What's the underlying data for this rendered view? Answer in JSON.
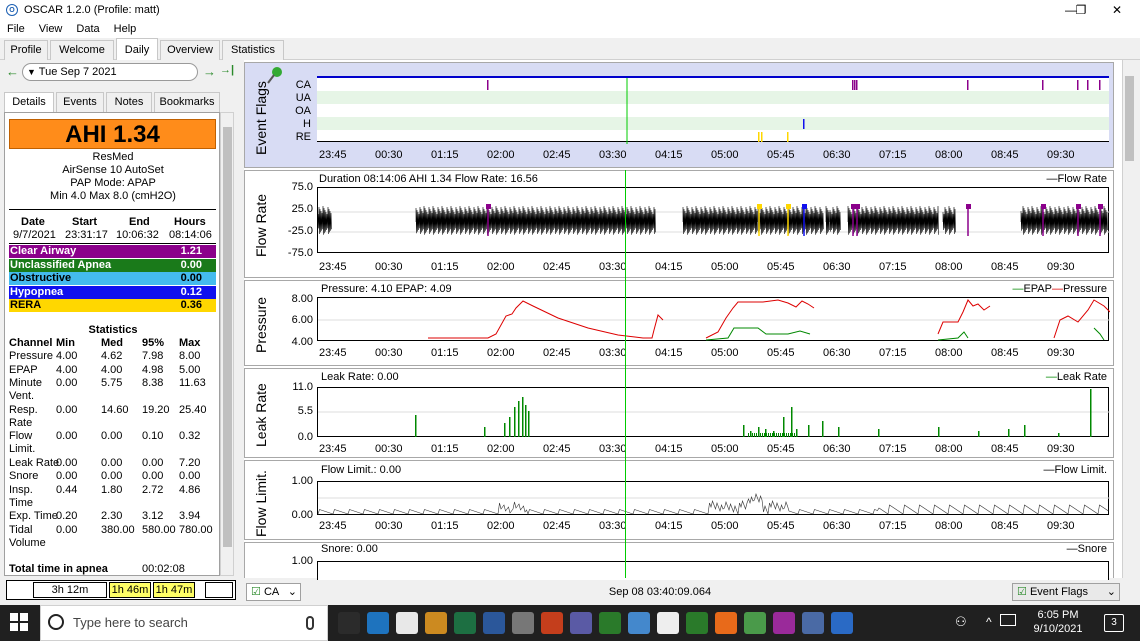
{
  "window": {
    "title": "OSCAR 1.2.0 (Profile: matt)",
    "minimize": "—",
    "maximize": "❐",
    "close": "✕"
  },
  "menu": [
    "File",
    "View",
    "Data",
    "Help"
  ],
  "tabs": [
    "Profile",
    "Welcome",
    "Daily",
    "Overview",
    "Statistics"
  ],
  "date_nav": {
    "back": "←",
    "forward": "→",
    "end": "→|",
    "date": "Tue Sep 7 2021",
    "dropdown_icon": "▼"
  },
  "subtabs": [
    "Details",
    "Events",
    "Notes",
    "Bookmarks"
  ],
  "details": {
    "ahi": "AHI 1.34",
    "device_brand": "ResMed",
    "device_model": "AirSense 10 AutoSet",
    "pap_mode": "PAP Mode: APAP",
    "pressure_range": "Min 4.0 Max 8.0 (cmH2O)",
    "session_headers": [
      "Date",
      "Start",
      "End",
      "Hours"
    ],
    "session_row": [
      "9/7/2021",
      "23:31:17",
      "10:06:32",
      "08:14:06"
    ],
    "events": [
      {
        "label": "Clear Airway",
        "value": "1.21",
        "color": "#8b008b",
        "text": "#ffffff"
      },
      {
        "label": "Unclassified Apnea",
        "value": "0.00",
        "color": "#1a7a1a",
        "text": "#ffffff"
      },
      {
        "label": "Obstructive",
        "value": "0.00",
        "color": "#44bbee",
        "text": "#000000"
      },
      {
        "label": "Hypopnea",
        "value": "0.12",
        "color": "#1010ee",
        "text": "#ffffff"
      },
      {
        "label": "RERA",
        "value": "0.36",
        "color": "#ffd700",
        "text": "#000000"
      }
    ],
    "stats_title": "Statistics",
    "stats_headers": [
      "Channel",
      "Min",
      "Med",
      "95%",
      "Max"
    ],
    "stats_rows": [
      {
        "name": "Pressure",
        "name2": "",
        "v": [
          "4.00",
          "4.62",
          "7.98",
          "8.00"
        ]
      },
      {
        "name": "EPAP",
        "name2": "",
        "v": [
          "4.00",
          "4.00",
          "4.98",
          "5.00"
        ]
      },
      {
        "name": "Minute",
        "name2": "Vent.",
        "v": [
          "0.00",
          "5.75",
          "8.38",
          "11.63"
        ]
      },
      {
        "name": "Resp.",
        "name2": "Rate",
        "v": [
          "0.00",
          "14.60",
          "19.20",
          "25.40"
        ]
      },
      {
        "name": "Flow",
        "name2": "Limit.",
        "v": [
          "0.00",
          "0.00",
          "0.10",
          "0.32"
        ]
      },
      {
        "name": "Leak Rate",
        "name2": "",
        "v": [
          "0.00",
          "0.00",
          "0.00",
          "7.20"
        ]
      },
      {
        "name": "Snore",
        "name2": "",
        "v": [
          "0.00",
          "0.00",
          "0.00",
          "0.00"
        ]
      },
      {
        "name": "Insp.",
        "name2": "Time",
        "v": [
          "0.44",
          "1.80",
          "2.72",
          "4.86"
        ]
      },
      {
        "name": "Exp. Time",
        "name2": "",
        "v": [
          "0.20",
          "2.30",
          "3.12",
          "3.94"
        ]
      },
      {
        "name": "Tidal",
        "name2": "Volume",
        "v": [
          "0.00",
          "380.00",
          "580.00",
          "780.00"
        ]
      }
    ],
    "total_apnea_label": "Total time in apnea",
    "total_apnea_value": "00:02:08"
  },
  "bottom_left": [
    "3h 12m",
    "1h 46m",
    "1h 47m"
  ],
  "time_ticks": [
    "23:45",
    "00:30",
    "01:15",
    "02:00",
    "02:45",
    "03:30",
    "04:15",
    "05:00",
    "05:45",
    "06:30",
    "07:15",
    "08:00",
    "08:45",
    "09:30"
  ],
  "graphs": {
    "event_flags": {
      "ylabel": "Event Flags",
      "channels": [
        "CA",
        "UA",
        "OA",
        "H",
        "RE"
      ]
    },
    "flow_rate": {
      "ylabel": "Flow Rate",
      "title": "Duration 08:14:06 AHI 1.34 Flow Rate: 16.56",
      "legend": "Flow Rate",
      "yticks": [
        "75.0",
        "25.0",
        "-25.0",
        "-75.0"
      ]
    },
    "pressure": {
      "ylabel": "Pressure",
      "title": "Pressure: 4.10 EPAP: 4.09",
      "legend_epap": "EPAP",
      "legend_pressure": "Pressure",
      "yticks": [
        "8.00",
        "6.00",
        "4.00"
      ]
    },
    "leak_rate": {
      "ylabel": "Leak Rate",
      "title": "Leak Rate: 0.00",
      "legend": "Leak Rate",
      "yticks": [
        "11.0",
        "5.5",
        "0.0"
      ]
    },
    "flow_limit": {
      "ylabel": "Flow Limit.",
      "title": "Flow Limit.: 0.00",
      "legend": "Flow Limit.",
      "yticks": [
        "1.00",
        "0.00"
      ]
    },
    "snore": {
      "title": "Snore: 0.00",
      "legend": "Snore",
      "yticks": [
        "1.00"
      ]
    }
  },
  "status": {
    "channel_combo": "CA",
    "datetime": "Sep 08 03:40:09.064",
    "flags_combo": "Event Flags"
  },
  "taskbar": {
    "search_placeholder": "Type here to search",
    "time": "6:05 PM",
    "date": "9/10/2021",
    "notifications": "3"
  },
  "colors": {
    "accent_ahi": "#ff8c1a",
    "cursor_line": "#00cc00",
    "pressure": "#dd0000",
    "epap": "#008800",
    "leak": "#008800",
    "event_flags_bg": "#e6f5e6"
  }
}
